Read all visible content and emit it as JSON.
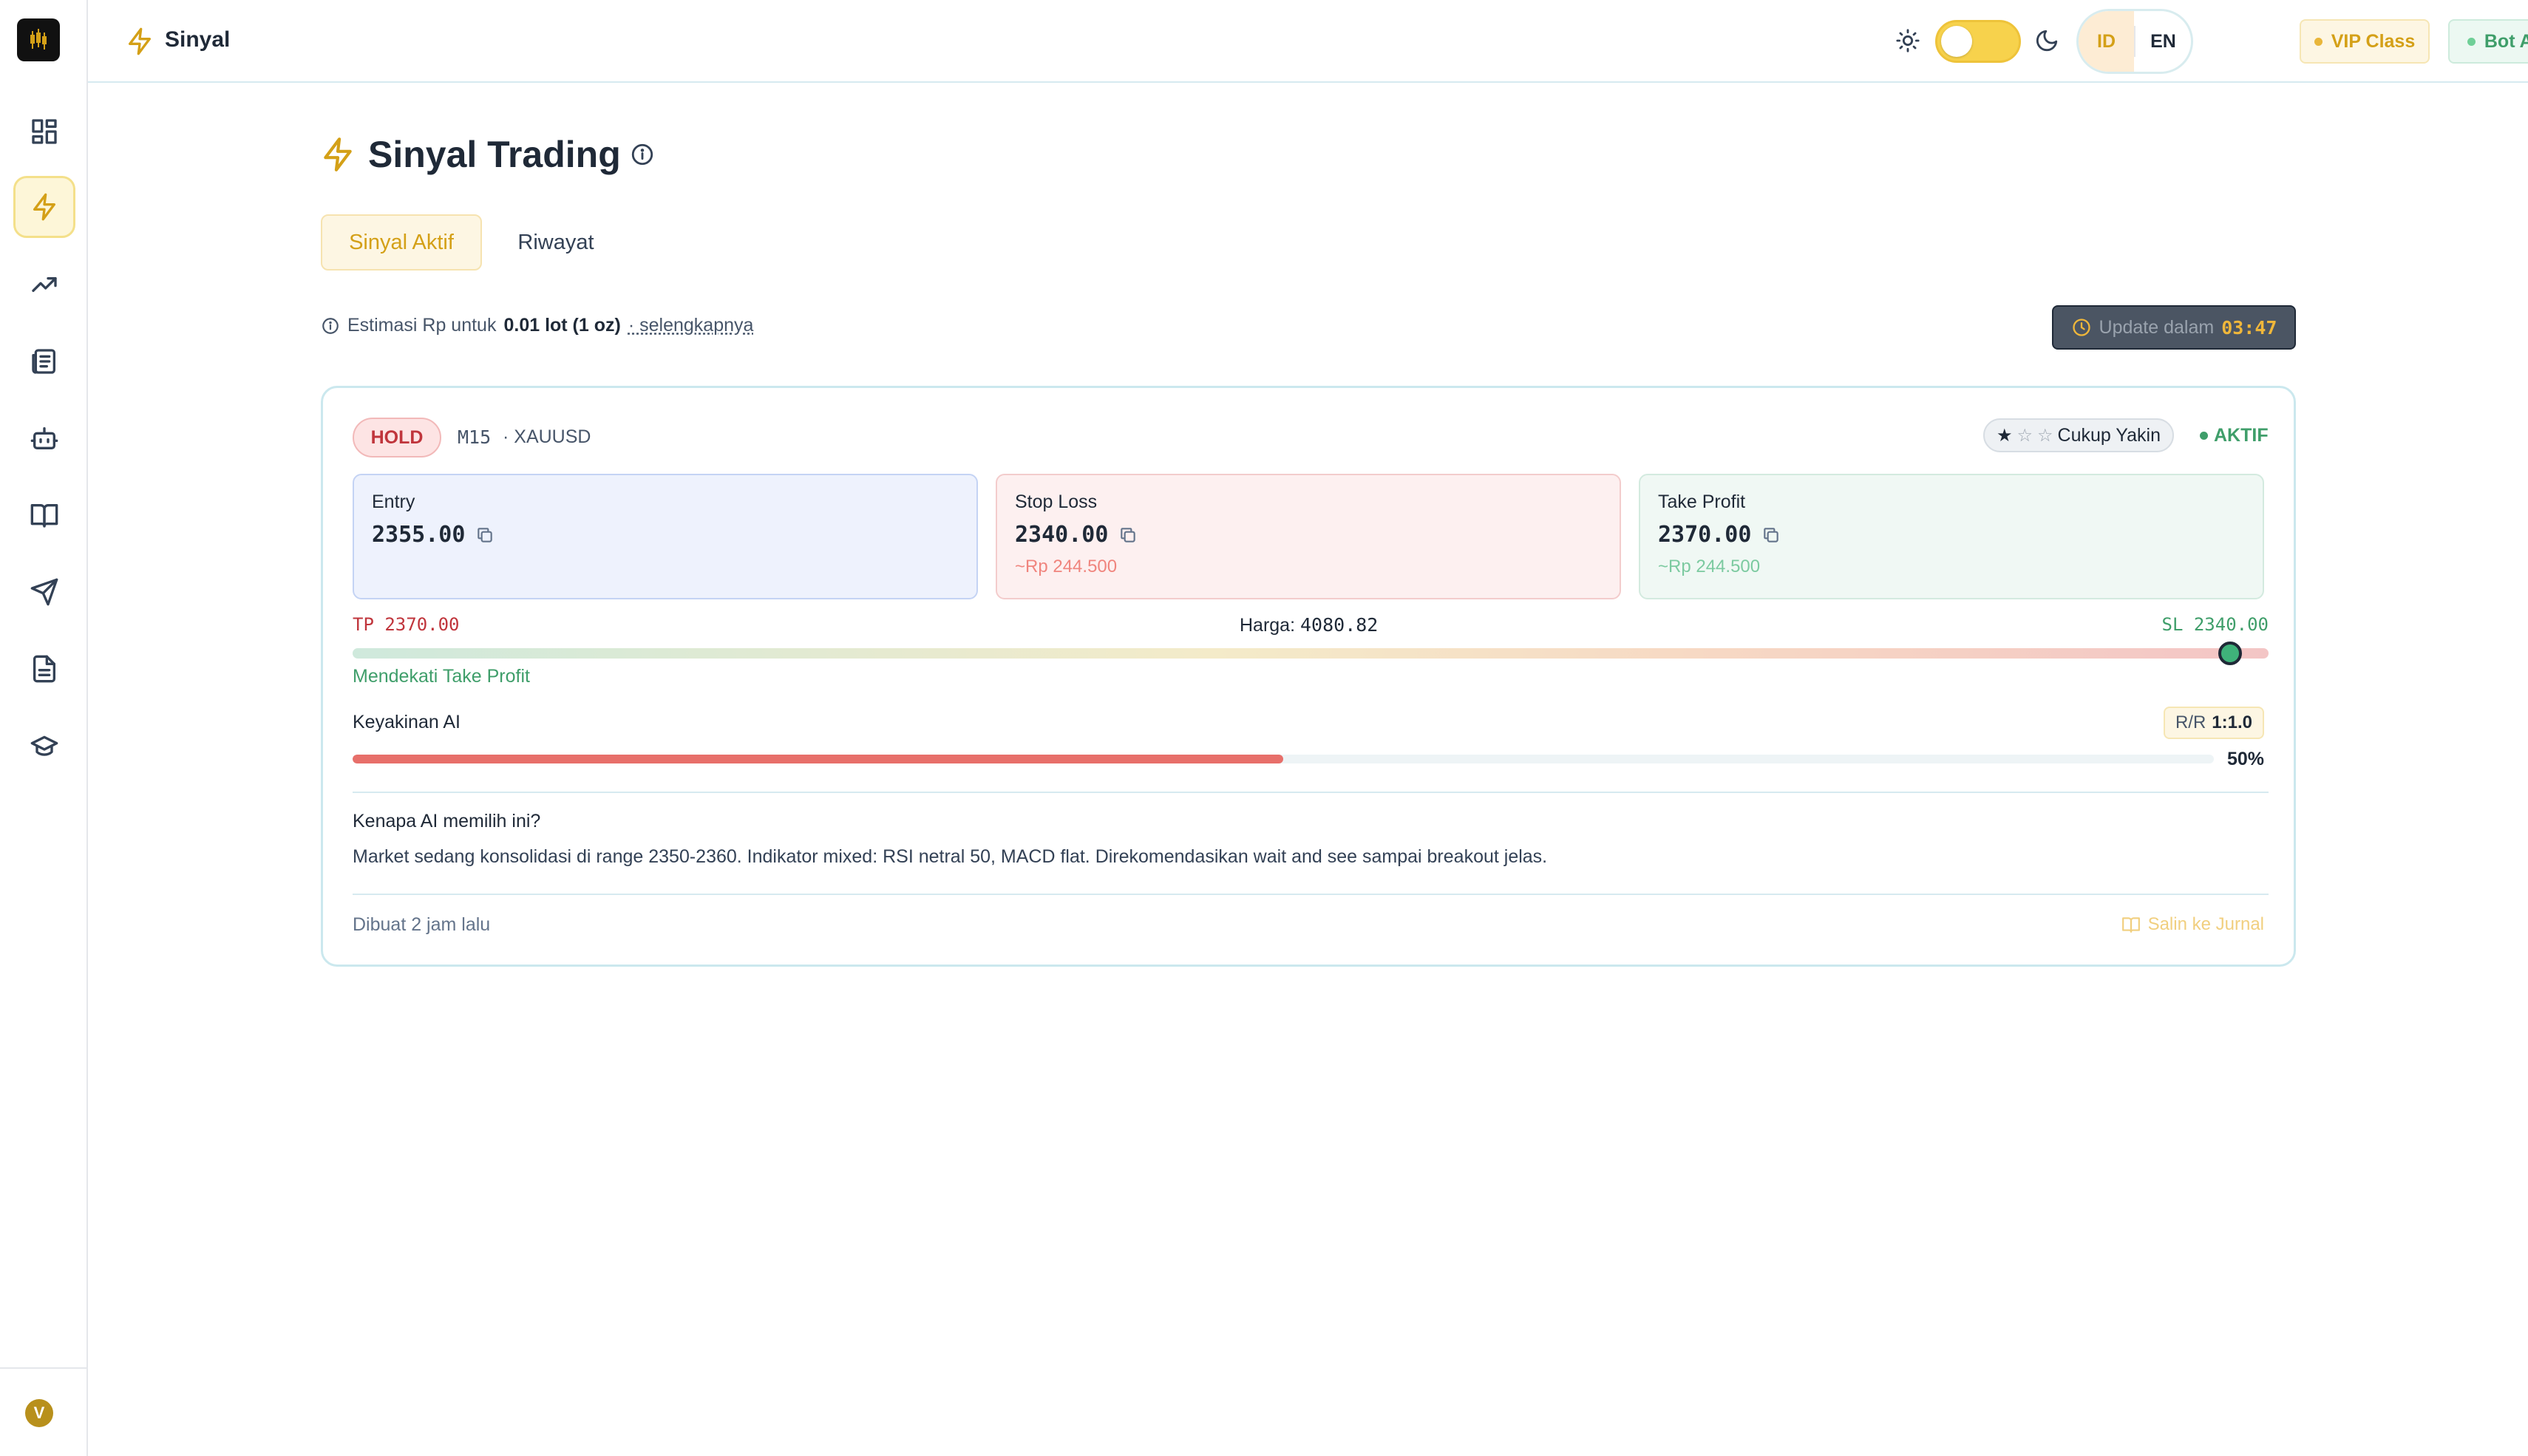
{
  "topbar": {
    "title": "Sinyal",
    "lang_options": [
      "ID",
      "EN"
    ],
    "vip_label": "VIP Class",
    "bot_label": "Bot Aktif"
  },
  "sidebar": {
    "items": [
      "dashboard-icon",
      "bolt-icon",
      "trending-up-icon",
      "news-icon",
      "bot-icon",
      "book-icon",
      "send-icon",
      "document-icon",
      "graduation-cap-icon"
    ],
    "avatar_initial": "V"
  },
  "page": {
    "title": "Sinyal Trading",
    "tabs": [
      "Sinyal Aktif",
      "Riwayat"
    ],
    "estimasi_prefix": "Estimasi Rp untuk",
    "estimasi_lot": "0.01 lot (1 oz)",
    "estimasi_more": "· selengkapnya",
    "update_label": "Update dalam",
    "update_time": "03:47"
  },
  "signal": {
    "action": "HOLD",
    "timeframe": "M15",
    "pair": "· XAUUSD",
    "confidence_label": "Cukup Yakin",
    "confidence_stars": 1,
    "confidence_max": 3,
    "status": "AKTIF",
    "entry_label": "Entry",
    "entry_value": "2355.00",
    "sl_label": "Stop Loss",
    "sl_value": "2340.00",
    "sl_rp": "~Rp 244.500",
    "tp_label": "Take Profit",
    "tp_value": "2370.00",
    "tp_rp": "~Rp 244.500",
    "range_tp": "TP 2370.00",
    "range_sl": "SL 2340.00",
    "harga_label": "Harga:",
    "harga_value": "4080.82",
    "range_position": 0.98,
    "range_status": "Mendekati Take Profit",
    "ai_label": "Keyakinan AI",
    "rr_label": "R/R",
    "rr_value": "1:1.0",
    "ai_percent": 50,
    "ai_percent_text": "50%",
    "why_question": "Kenapa AI memilih ini?",
    "why_answer": "Market sedang konsolidasi di range 2350-2360. Indikator mixed: RSI netral 50, MACD flat. Direkomendasikan wait and see sampai breakout jelas.",
    "created": "Dibuat 2 jam lalu",
    "journal_label": "Salin ke Jurnal"
  },
  "colors": {
    "accent": "#d4a017",
    "success": "#3f9e6a",
    "danger": "#c0353c"
  }
}
